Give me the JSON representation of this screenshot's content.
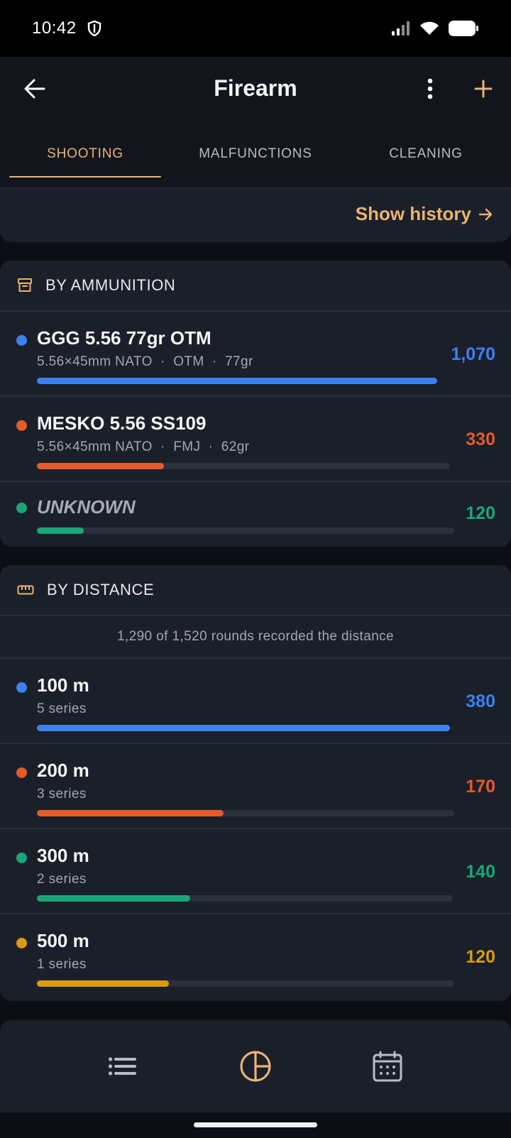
{
  "status_bar": {
    "time": "10:42"
  },
  "app_bar": {
    "title": "Firearm"
  },
  "tabs": [
    {
      "label": "SHOOTING",
      "active": true
    },
    {
      "label": "MALFUNCTIONS",
      "active": false
    },
    {
      "label": "CLEANING",
      "active": false
    }
  ],
  "history": {
    "label": "Show history"
  },
  "by_ammunition": {
    "title": "BY AMMUNITION",
    "items": [
      {
        "name": "GGG 5.56 77gr OTM",
        "details": "5.56×45mm NATO  ·  OTM  ·  77gr",
        "value": "1,070",
        "fraction": 1.0,
        "color": "#3b82f0"
      },
      {
        "name": "MESKO 5.56 SS109",
        "details": "5.56×45mm NATO  ·  FMJ  ·  62gr",
        "value": "330",
        "fraction": 0.308,
        "color": "#e35b2a"
      },
      {
        "name": "UNKNOWN",
        "details": "",
        "value": "120",
        "fraction": 0.112,
        "color": "#1ba67a"
      }
    ]
  },
  "by_distance": {
    "title": "BY DISTANCE",
    "summary": "1,290 of 1,520 rounds recorded the distance",
    "items": [
      {
        "name": "100 m",
        "details": "5 series",
        "value": "380",
        "fraction": 1.0,
        "color": "#3b82f0"
      },
      {
        "name": "200 m",
        "details": "3 series",
        "value": "170",
        "fraction": 0.447,
        "color": "#e35b2a"
      },
      {
        "name": "300 m",
        "details": "2 series",
        "value": "140",
        "fraction": 0.368,
        "color": "#1ba67a"
      },
      {
        "name": "500 m",
        "details": "1 series",
        "value": "120",
        "fraction": 0.316,
        "color": "#d99a14"
      }
    ]
  },
  "colors": {
    "accent": "#e9b373",
    "background": "#0c0e13",
    "card": "#1b1f2a"
  },
  "bottom_nav": [
    {
      "icon": "list-icon",
      "active": false
    },
    {
      "icon": "pie-chart-icon",
      "active": true
    },
    {
      "icon": "calendar-icon",
      "active": false
    }
  ]
}
